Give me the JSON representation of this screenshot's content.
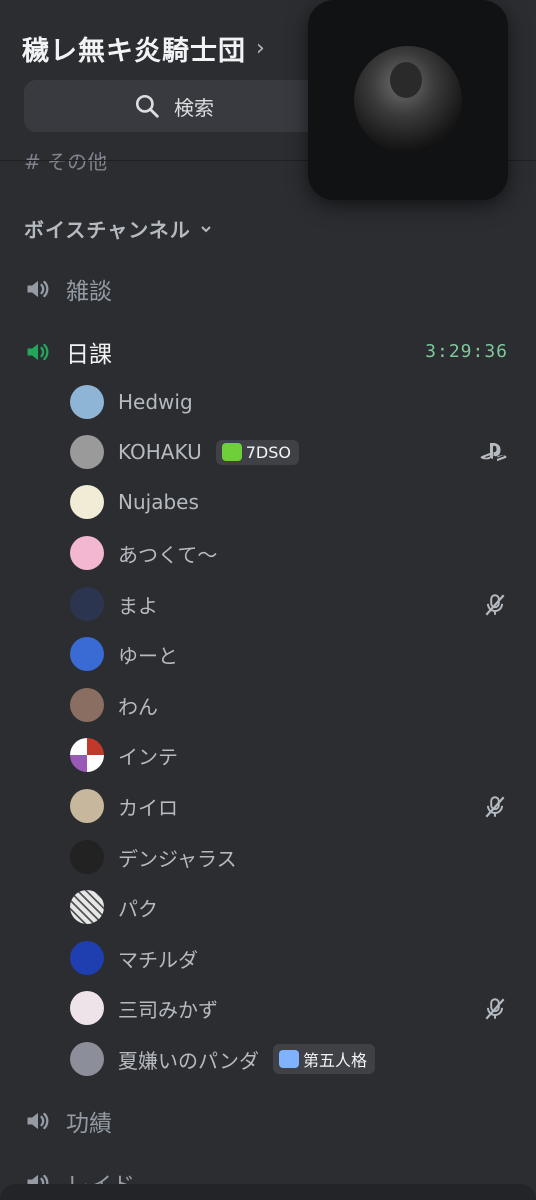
{
  "server": {
    "name": "穢レ無キ炎騎士団",
    "search_label": "検索"
  },
  "clipped_category": "その他",
  "voice_category": "ボイスチャンネル",
  "channels": {
    "zatsudan": "雑談",
    "nikka": "日課",
    "nikka_timer": "3:29:36",
    "koseki": "功績",
    "raid": "レイド"
  },
  "members": [
    {
      "name": "Hedwig",
      "avatar": "#8fb5d6"
    },
    {
      "name": "KOHAKU",
      "avatar": "#9a9a9a",
      "badge": "7DSO",
      "badge_color": "#6fcf3a",
      "status_icon": "playstation-icon"
    },
    {
      "name": "Nujabes",
      "avatar": "#f1ecd6"
    },
    {
      "name": "あつくて〜",
      "avatar": "#f3b7d2"
    },
    {
      "name": "まよ",
      "avatar": "#2c3550",
      "status_icon": "mic-muted-icon"
    },
    {
      "name": "ゆーと",
      "avatar": "#3a6ad4"
    },
    {
      "name": "わん",
      "avatar": "#8a6e62"
    },
    {
      "name": "インテ",
      "avatar": "#ffffff"
    },
    {
      "name": "カイロ",
      "avatar": "#c7b79d",
      "status_icon": "mic-muted-icon"
    },
    {
      "name": "デンジャラス",
      "avatar": "#222222"
    },
    {
      "name": "パク",
      "avatar": "#e6e6e6"
    },
    {
      "name": "マチルダ",
      "avatar": "#1f3fb0"
    },
    {
      "name": "三司みかず",
      "avatar": "#efe3ea",
      "status_icon": "mic-muted-icon"
    },
    {
      "name": "夏嫌いのパンダ",
      "avatar": "#8c8f9a",
      "badge": "第五人格",
      "badge_color": "#7fb2ff"
    }
  ],
  "colors": {
    "accent_green": "#23a55a",
    "timer_green": "#7fc89a",
    "background": "#2b2d31"
  }
}
